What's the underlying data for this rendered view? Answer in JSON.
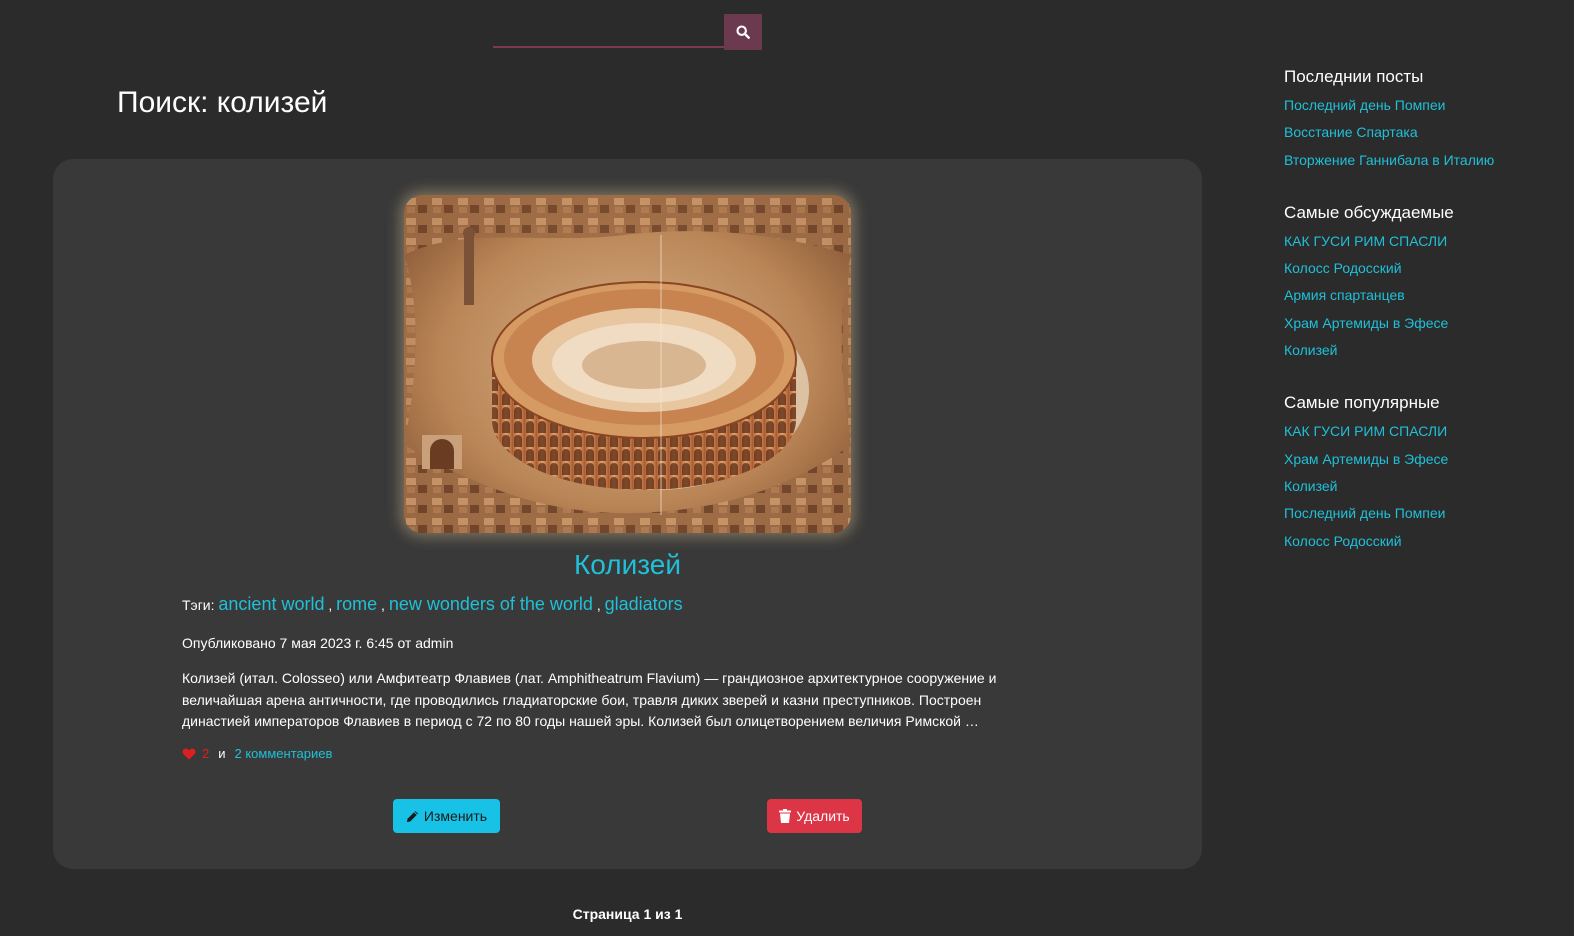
{
  "search": {
    "value": "",
    "placeholder": "",
    "button_icon": "search-icon"
  },
  "page_title": "Поиск: колизей",
  "post": {
    "image_alt": "Колизей",
    "title": "Колизей",
    "tags_label": "Тэги:",
    "tags": [
      "ancient world",
      "rome",
      "new wonders of the world",
      "gladiators"
    ],
    "tag_separator": ",",
    "published": "Опубликовано 7 мая 2023 г. 6:45 от admin",
    "excerpt_lines": [
      "Колизей (итал. Colosseo) или Амфитеатр Флавиев (лат. Amphitheatrum Flavium) — грандиозное архитектурное сооружение и",
      "величайшая арена античности, где проводились гладиаторские бои, травля диких зверей и казни преступников. Построен",
      "династией императоров Флавиев в период с 72 по 80 годы нашей эры. Колизей был олицетворением величия Римской …"
    ],
    "likes_icon": "heart-icon",
    "likes": "2",
    "and_text": "и",
    "comments": "2 комментариев",
    "edit_label": "Изменить",
    "delete_label": "Удалить"
  },
  "pagination": "Страница 1 из 1",
  "sidebar": {
    "sections": [
      {
        "heading": "Последнии посты",
        "items": [
          "Последний день Помпеи",
          "Восстание Спартака",
          "Вторжение Ганнибала в Италию"
        ]
      },
      {
        "heading": "Самые обсуждаемые",
        "items": [
          "КАК ГУСИ РИМ СПАСЛИ",
          "Колосс Родосский",
          "Армия спартанцев",
          "Храм Артемиды в Эфесе",
          "Колизей"
        ]
      },
      {
        "heading": "Самые популярные",
        "items": [
          "КАК ГУСИ РИМ СПАСЛИ",
          "Храм Артемиды в Эфесе",
          "Колизей",
          "Последний день Помпеи",
          "Колосс Родосский"
        ]
      }
    ]
  },
  "colors": {
    "background": "#2b2b2b",
    "card": "#393939",
    "accent_link": "#1fc0d8",
    "search_button": "#6b3a4f",
    "edit_button": "#17c2e6",
    "delete_button": "#dc3545",
    "like": "#dc2020"
  }
}
